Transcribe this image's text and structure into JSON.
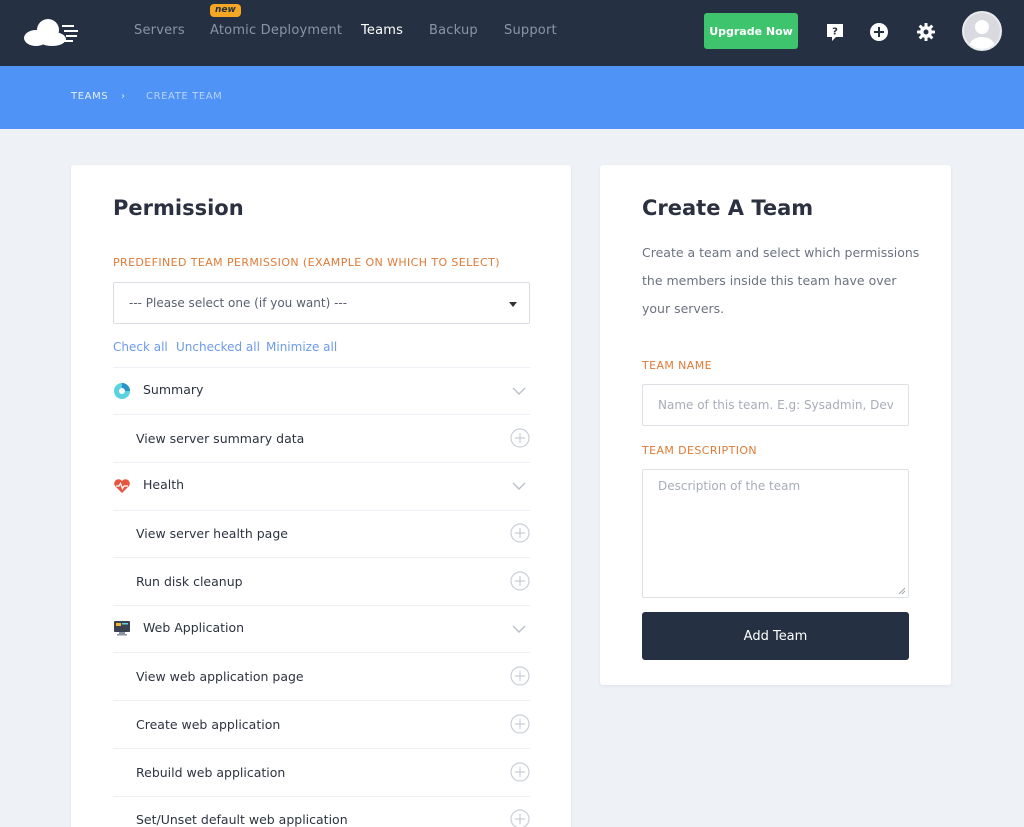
{
  "nav": {
    "items": [
      {
        "label": "Servers"
      },
      {
        "label": "Atomic Deployment",
        "badge": "new"
      },
      {
        "label": "Teams"
      },
      {
        "label": "Backup"
      },
      {
        "label": "Support"
      }
    ],
    "active": "Teams",
    "upgrade_label": "Upgrade Now",
    "icons": [
      "cloud-logo-icon",
      "help-icon",
      "add-circle-icon",
      "gear-icon",
      "avatar"
    ]
  },
  "breadcrumb": {
    "items": [
      "TEAMS",
      "CREATE TEAM"
    ],
    "separator": "›"
  },
  "permission": {
    "title": "Permission",
    "predefined_label": "PREDEFINED TEAM PERMISSION (EXAMPLE ON WHICH TO SELECT)",
    "select_value": "--- Please select one (if you want) ---",
    "links": [
      "Check all",
      "Unchecked all",
      "Minimize all"
    ],
    "groups": [
      {
        "label": "Summary",
        "icon": "pie-chart-icon",
        "items": [
          "View server summary data"
        ]
      },
      {
        "label": "Health",
        "icon": "heartbeat-icon",
        "items": [
          "View server health page",
          "Run disk cleanup"
        ]
      },
      {
        "label": "Web Application",
        "icon": "monitor-icon",
        "items": [
          "View web application page",
          "Create web application",
          "Rebuild web application",
          "Set/Unset default web application"
        ]
      }
    ]
  },
  "create_team": {
    "title": "Create A Team",
    "description": [
      "Create a team and select which permissions",
      "the members inside this team have over",
      "your servers."
    ],
    "team_name_label": "TEAM NAME",
    "team_name_placeholder": "Name of this team. E.g: Sysadmin, Developer",
    "team_desc_label": "TEAM DESCRIPTION",
    "team_desc_placeholder": "Description of the team",
    "submit_label": "Add Team"
  },
  "colors": {
    "nav_bg": "#253142",
    "crumb_bg": "#4f93f7",
    "upgrade_green": "#3ec46d",
    "label_orange": "#e07a36",
    "link_blue": "#6d9be8"
  }
}
